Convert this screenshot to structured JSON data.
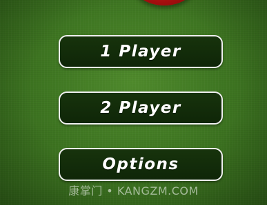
{
  "menu": {
    "one_player": "1 Player",
    "two_player": "2 Player",
    "options": "Options"
  },
  "watermark": "康掌门 • KANGZM.COM",
  "colors": {
    "felt": "#3f7722",
    "button_fill": "#143009",
    "button_border": "#f0f0f0",
    "ball": "#c41818"
  }
}
